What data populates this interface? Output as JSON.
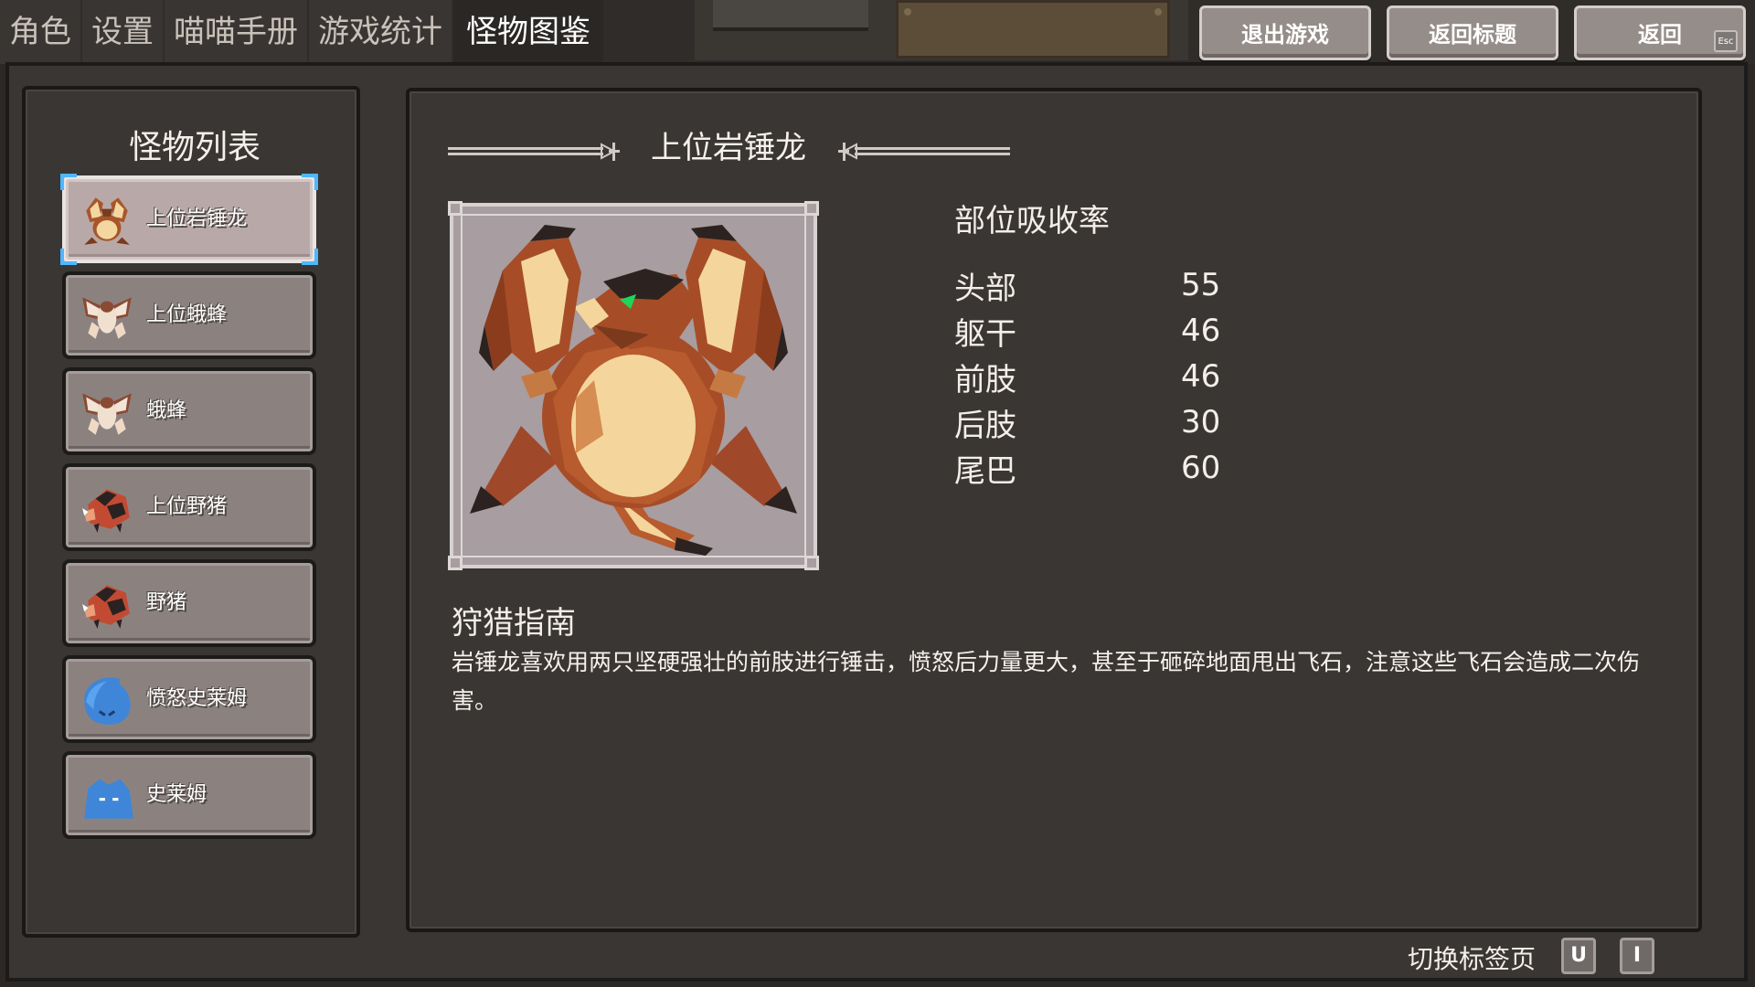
{
  "tabs": [
    "角色",
    "设置",
    "喵喵手册",
    "游戏统计",
    "怪物图鉴"
  ],
  "active_tab": "怪物图鉴",
  "top_buttons": {
    "quit": "退出游戏",
    "title": "返回标题",
    "back": "返回",
    "esc_key": "Esc"
  },
  "monster_list": {
    "title": "怪物列表",
    "items": [
      {
        "name": "上位岩锤龙",
        "icon": "rock-hammer-dragon-icon",
        "selected": true
      },
      {
        "name": "上位蛾蜂",
        "icon": "moth-bee-icon",
        "selected": false
      },
      {
        "name": "蛾蜂",
        "icon": "moth-bee-icon",
        "selected": false
      },
      {
        "name": "上位野猪",
        "icon": "boar-icon",
        "selected": false
      },
      {
        "name": "野猪",
        "icon": "boar-icon",
        "selected": false
      },
      {
        "name": "愤怒史莱姆",
        "icon": "angry-slime-icon",
        "selected": false
      },
      {
        "name": "史莱姆",
        "icon": "slime-icon",
        "selected": false
      }
    ]
  },
  "detail": {
    "name": "上位岩锤龙",
    "portrait_icon": "rock-hammer-dragon-portrait",
    "absorption": {
      "title": "部位吸收率",
      "rows": [
        {
          "part": "头部",
          "value": "55"
        },
        {
          "part": "躯干",
          "value": "46"
        },
        {
          "part": "前肢",
          "value": "46"
        },
        {
          "part": "后肢",
          "value": "30"
        },
        {
          "part": "尾巴",
          "value": "60"
        }
      ]
    },
    "guide": {
      "title": "狩猎指南",
      "text": "岩锤龙喜欢用两只坚硬强壮的前肢进行锤击，愤怒后力量更大，甚至于砸碎地面甩出飞石，注意这些飞石会造成二次伤害。"
    }
  },
  "footer": {
    "hint": "切换标签页",
    "keys": [
      "U",
      "I"
    ]
  }
}
